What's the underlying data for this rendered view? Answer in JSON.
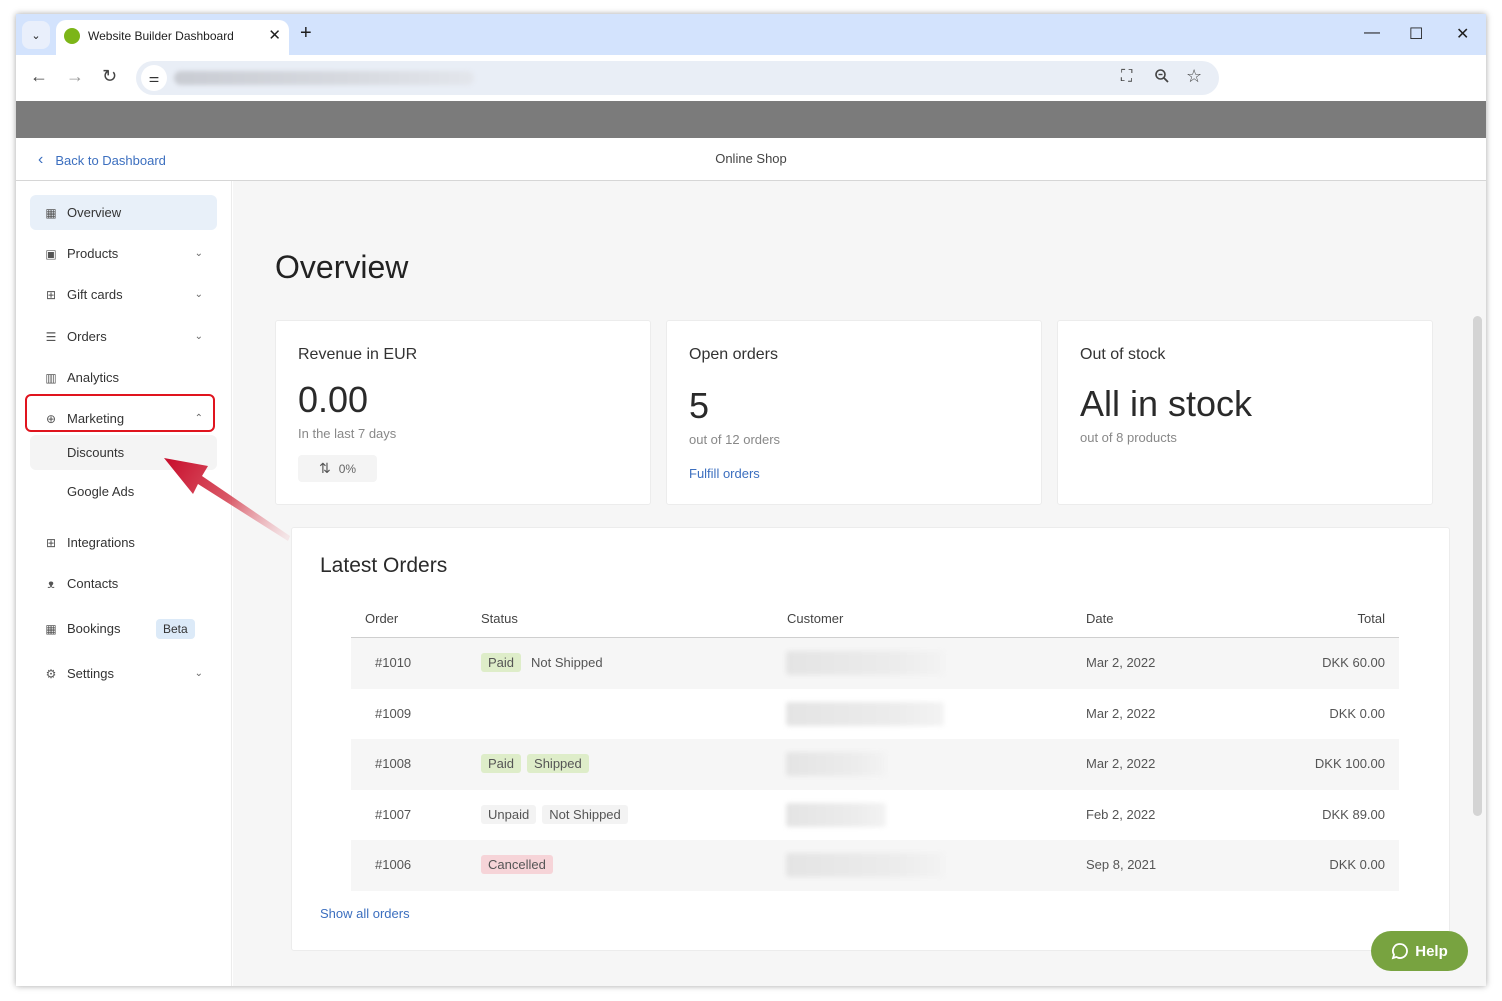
{
  "browser": {
    "tab_title": "Website Builder Dashboard",
    "icons": {
      "tab_menu": "chevron-down-icon",
      "close_tab": "close-icon",
      "new_tab": "plus-icon",
      "back": "arrow-left-icon",
      "forward": "arrow-right-icon",
      "reload": "reload-icon",
      "site_info": "tune-icon",
      "translate": "translate-icon",
      "zoom": "zoom-out-icon",
      "bookmark": "star-icon",
      "minimize": "minimize-icon",
      "maximize": "maximize-icon",
      "close_window": "close-icon"
    },
    "glyphs": {
      "tab_menu": "⌄",
      "close_tab": "✕",
      "new_tab": "+",
      "back": "←",
      "forward": "→",
      "reload": "↻",
      "site_info": "⚌",
      "translate": "⛶",
      "zoom": "🔍︎",
      "bookmark": "☆",
      "minimize": "—",
      "maximize": "☐",
      "close_window": "✕"
    }
  },
  "header": {
    "back_label": "Back to Dashboard",
    "back_glyph": "‹",
    "shop_title": "Online Shop"
  },
  "sidebar": {
    "items": [
      {
        "label": "Overview",
        "icon": "grid-icon",
        "glyph": "▦",
        "active": true
      },
      {
        "label": "Products",
        "icon": "product-icon",
        "glyph": "▣",
        "chevron": "⌄"
      },
      {
        "label": "Gift cards",
        "icon": "gift-icon",
        "glyph": "⊞",
        "chevron": "⌄"
      },
      {
        "label": "Orders",
        "icon": "orders-icon",
        "glyph": "☰",
        "chevron": "⌄"
      },
      {
        "label": "Analytics",
        "icon": "analytics-icon",
        "glyph": "▥"
      },
      {
        "label": "Marketing",
        "icon": "target-icon",
        "glyph": "⊕",
        "chevron": "⌃",
        "expanded": true
      },
      {
        "label": "Integrations",
        "icon": "integrations-icon",
        "glyph": "⊞"
      },
      {
        "label": "Contacts",
        "icon": "contacts-icon",
        "glyph": "ᴥ"
      },
      {
        "label": "Bookings",
        "icon": "calendar-icon",
        "glyph": "▦",
        "badge": "Beta"
      },
      {
        "label": "Settings",
        "icon": "gear-icon",
        "glyph": "⚙",
        "chevron": "⌄"
      }
    ],
    "marketing_sub": [
      {
        "label": "Discounts"
      },
      {
        "label": "Google Ads"
      }
    ]
  },
  "main": {
    "page_title": "Overview",
    "cards": {
      "revenue": {
        "title": "Revenue in EUR",
        "value": "0.00",
        "sub": "In the last 7 days",
        "trend_glyph": "⇅",
        "trend": "0%"
      },
      "open_orders": {
        "title": "Open orders",
        "value": "5",
        "sub": "out of 12 orders",
        "link": "Fulfill orders"
      },
      "stock": {
        "title": "Out of stock",
        "value": "All in stock",
        "sub": "out of 8 products"
      }
    },
    "latest_orders": {
      "title": "Latest Orders",
      "columns": [
        "Order",
        "Status",
        "Customer",
        "Date",
        "Total"
      ],
      "rows": [
        {
          "order": "#1010",
          "badges": [
            {
              "text": "Paid",
              "style": "green"
            },
            {
              "text": "Not Shipped",
              "style": "plain"
            }
          ],
          "date": "Mar 2, 2022",
          "total": "DKK 60.00"
        },
        {
          "order": "#1009",
          "badges": [],
          "date": "Mar 2, 2022",
          "total": "DKK 0.00"
        },
        {
          "order": "#1008",
          "badges": [
            {
              "text": "Paid",
              "style": "green"
            },
            {
              "text": "Shipped",
              "style": "green"
            }
          ],
          "date": "Mar 2, 2022",
          "total": "DKK 100.00"
        },
        {
          "order": "#1007",
          "badges": [
            {
              "text": "Unpaid",
              "style": "gray"
            },
            {
              "text": "Not Shipped",
              "style": "gray"
            }
          ],
          "date": "Feb 2, 2022",
          "total": "DKK 89.00"
        },
        {
          "order": "#1006",
          "badges": [
            {
              "text": "Cancelled",
              "style": "red"
            }
          ],
          "date": "Sep 8, 2021",
          "total": "DKK 0.00"
        }
      ],
      "show_all": "Show all orders"
    },
    "help_label": "Help",
    "help_glyph": "◯"
  },
  "colors": {
    "accent_link": "#3c6fbf",
    "help_green": "#78a340",
    "highlight_red": "#e0141e",
    "tabstrip": "#d3e3fd"
  }
}
